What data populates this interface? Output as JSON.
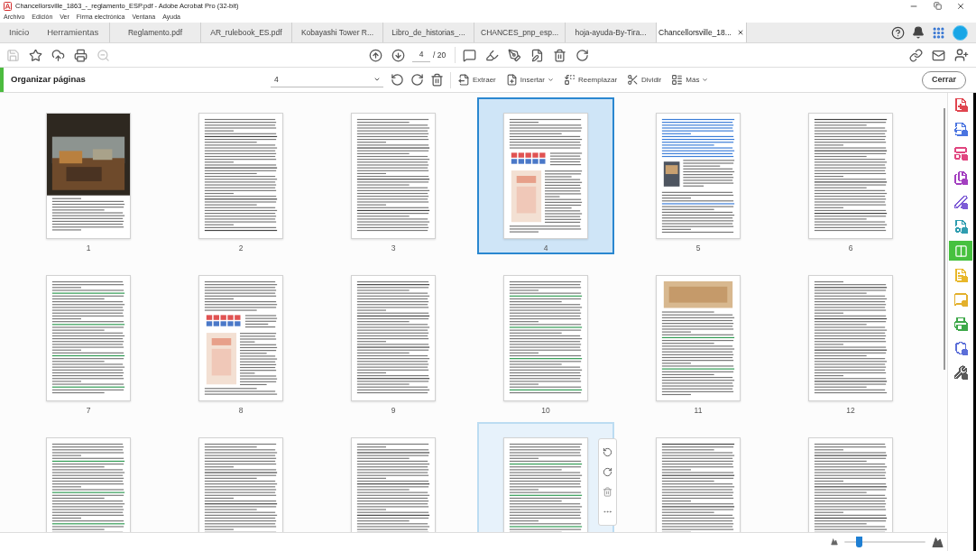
{
  "window": {
    "title": "Chancellorsville_1863_-_reglamento_ESP.pdf - Adobe Acrobat Pro (32-bit)"
  },
  "menu": [
    "Archivo",
    "Edición",
    "Ver",
    "Firma electrónica",
    "Ventana",
    "Ayuda"
  ],
  "tabs": [
    {
      "kind": "nav",
      "label": "Inicio",
      "selected": false
    },
    {
      "kind": "nav",
      "label": "Herramientas",
      "selected": false
    },
    {
      "kind": "document",
      "label": "Reglamento.pdf",
      "selected": false
    },
    {
      "kind": "document",
      "label": "AR_rulebook_ES.pdf",
      "selected": false
    },
    {
      "kind": "document",
      "label": "Kobayashi Tower R...",
      "selected": false
    },
    {
      "kind": "document",
      "label": "Libro_de_historias_...",
      "selected": false
    },
    {
      "kind": "document",
      "label": "CHANCES_pnp_esp...",
      "selected": false
    },
    {
      "kind": "document",
      "label": "hoja-ayuda-By-Tira...",
      "selected": false
    },
    {
      "kind": "document",
      "label": "Chancellorsville_18...",
      "selected": true
    }
  ],
  "toolbar": {
    "tools": [
      {
        "disabled": true
      },
      {
        "disabled": false
      },
      {
        "disabled": false
      },
      {
        "disabled": false
      },
      {
        "disabled": true
      }
    ],
    "page_field": {
      "value": "4"
    },
    "page_total": "/ 20"
  },
  "organize_bar": {
    "title": "Organizar páginas",
    "page_select": {
      "value": "4"
    },
    "actions": [
      {
        "label": "Extraer",
        "has_menu": false
      },
      {
        "label": "Insertar",
        "has_menu": true
      },
      {
        "label": "Reemplazar",
        "has_menu": false
      },
      {
        "label": "Dividir",
        "has_menu": false
      },
      {
        "label": "Más",
        "has_menu": true
      }
    ],
    "close_button": "Cerrar"
  },
  "pages": [
    {
      "number": "1",
      "kind": "cover",
      "selected": false,
      "hovered": false
    },
    {
      "number": "2",
      "kind": "text",
      "selected": false,
      "hovered": false
    },
    {
      "number": "3",
      "kind": "text",
      "selected": false,
      "hovered": false
    },
    {
      "number": "4",
      "kind": "figure",
      "selected": true,
      "hovered": false
    },
    {
      "number": "5",
      "kind": "figure",
      "selected": false,
      "hovered": false
    },
    {
      "number": "6",
      "kind": "text",
      "selected": false,
      "hovered": false
    },
    {
      "number": "7",
      "kind": "text",
      "selected": false,
      "hovered": false
    },
    {
      "number": "8",
      "kind": "figure",
      "selected": false,
      "hovered": false
    },
    {
      "number": "9",
      "kind": "text",
      "selected": false,
      "hovered": false
    },
    {
      "number": "10",
      "kind": "text",
      "selected": false,
      "hovered": false
    },
    {
      "number": "11",
      "kind": "figure",
      "selected": false,
      "hovered": false
    },
    {
      "number": "12",
      "kind": "text",
      "selected": false,
      "hovered": false
    },
    {
      "kind": "text",
      "selected": false,
      "hovered": false
    },
    {
      "kind": "text",
      "selected": false,
      "hovered": false
    },
    {
      "kind": "text",
      "selected": false,
      "hovered": false
    },
    {
      "kind": "text",
      "selected": false,
      "hovered": true
    },
    {
      "kind": "text",
      "selected": false,
      "hovered": false
    },
    {
      "kind": "text",
      "selected": false,
      "hovered": false
    }
  ],
  "tools_panel": [
    {
      "color": "#e0454f",
      "selected": false
    },
    {
      "color": "#4a74e0",
      "selected": false
    },
    {
      "color": "#e0457f",
      "selected": false
    },
    {
      "color": "#a33fc0",
      "selected": false
    },
    {
      "color": "#7d5bd6",
      "selected": false
    },
    {
      "color": "#2f9db0",
      "selected": false
    },
    {
      "color": "#46c13f",
      "selected": true
    },
    {
      "color": "#e8b72a",
      "selected": false
    },
    {
      "color": "#e3b02c",
      "selected": false
    },
    {
      "color": "#3ea84a",
      "selected": false
    },
    {
      "color": "#5b6ed8",
      "selected": false
    },
    {
      "color": "#5a5a5a",
      "selected": false
    }
  ],
  "zoom_slider": {
    "level": 0.18
  }
}
